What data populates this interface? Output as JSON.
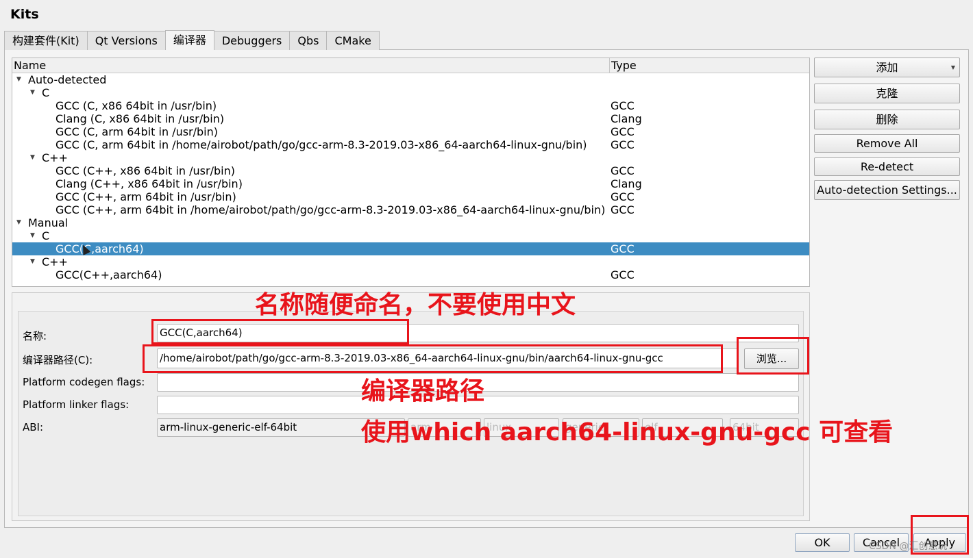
{
  "window": {
    "title": "Kits"
  },
  "tabs": [
    "构建套件(Kit)",
    "Qt Versions",
    "编译器",
    "Debuggers",
    "Qbs",
    "CMake"
  ],
  "tree": {
    "headers": {
      "name": "Name",
      "type": "Type"
    },
    "rows": [
      {
        "name": "Auto-detected",
        "type": "",
        "level": 0,
        "expandable": true
      },
      {
        "name": "C",
        "type": "",
        "level": 1,
        "expandable": true
      },
      {
        "name": "GCC (C, x86 64bit in /usr/bin)",
        "type": "GCC",
        "level": 2
      },
      {
        "name": "Clang (C, x86 64bit in /usr/bin)",
        "type": "Clang",
        "level": 2
      },
      {
        "name": "GCC (C, arm 64bit in /usr/bin)",
        "type": "GCC",
        "level": 2
      },
      {
        "name": "GCC (C, arm 64bit in /home/airobot/path/go/gcc-arm-8.3-2019.03-x86_64-aarch64-linux-gnu/bin)",
        "type": "GCC",
        "level": 2
      },
      {
        "name": "C++",
        "type": "",
        "level": 1,
        "expandable": true
      },
      {
        "name": "GCC (C++, x86 64bit in /usr/bin)",
        "type": "GCC",
        "level": 2
      },
      {
        "name": "Clang (C++, x86 64bit in /usr/bin)",
        "type": "Clang",
        "level": 2
      },
      {
        "name": "GCC (C++, arm 64bit in /usr/bin)",
        "type": "GCC",
        "level": 2
      },
      {
        "name": "GCC (C++, arm 64bit in /home/airobot/path/go/gcc-arm-8.3-2019.03-x86_64-aarch64-linux-gnu/bin)",
        "type": "GCC",
        "level": 2
      },
      {
        "name": "Manual",
        "type": "",
        "level": 0,
        "expandable": true
      },
      {
        "name": "C",
        "type": "",
        "level": 1,
        "expandable": true
      },
      {
        "name": "GCC(C,aarch64)",
        "type": "GCC",
        "level": 2,
        "selected": true
      },
      {
        "name": "C++",
        "type": "",
        "level": 1,
        "expandable": true
      },
      {
        "name": "GCC(C++,aarch64)",
        "type": "GCC",
        "level": 2
      }
    ]
  },
  "buttons": {
    "add": "添加",
    "clone": "克隆",
    "remove": "删除",
    "remove_all": "Remove All",
    "redetect": "Re-detect",
    "autodetect_settings": "Auto-detection Settings..."
  },
  "form": {
    "name_label": "名称:",
    "name_value": "GCC(C,aarch64)",
    "path_label": "编译器路径(C):",
    "path_value": "/home/airobot/path/go/gcc-arm-8.3-2019.03-x86_64-aarch64-linux-gnu/bin/aarch64-linux-gnu-gcc",
    "browse": "浏览...",
    "codegen_label": "Platform codegen flags:",
    "codegen_value": "",
    "linker_label": "Platform linker flags:",
    "linker_value": "",
    "abi_label": "ABI:",
    "abi_value": "arm-linux-generic-elf-64bit",
    "abi_parts": [
      "arm",
      "linux",
      "generic",
      "elf",
      "64bit"
    ]
  },
  "annotations": {
    "name_note": "名称随便命名，不要使用中文",
    "path_note": "编译器路径",
    "which_note": "使用which aarch64-linux-gnu-gcc 可查看",
    "color": "#e8141b"
  },
  "footer": {
    "ok": "OK",
    "cancel": "Cancel",
    "apply": "Apply"
  },
  "watermark": "CSDN @汇创慧玩",
  "colors": {
    "selection": "#3d8cc2",
    "annotation_red": "#e8141b"
  }
}
